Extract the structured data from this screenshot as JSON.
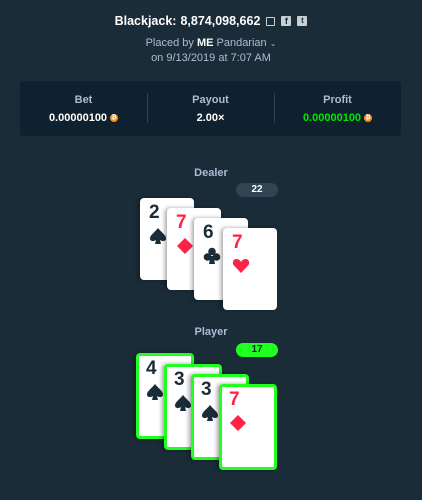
{
  "header": {
    "game": "Blackjack:",
    "bet_id": "8,874,098,662",
    "placed_prefix": "Placed by",
    "username_tag": "ME",
    "username": "Pandarian",
    "timestamp": "on 9/13/2019 at 7:07 AM"
  },
  "stats": {
    "bet_label": "Bet",
    "bet_value": "0.00000100",
    "payout_label": "Payout",
    "payout_value": "2.00×",
    "profit_label": "Profit",
    "profit_value": "0.00000100",
    "currency_icon": "bitcoin-icon"
  },
  "dealer": {
    "label": "Dealer",
    "score": "22",
    "cards": [
      {
        "rank": "2",
        "suit": "spade",
        "color": "#1a2c38"
      },
      {
        "rank": "7",
        "suit": "diamond",
        "color": "#fe2247"
      },
      {
        "rank": "6",
        "suit": "club",
        "color": "#1a2c38"
      },
      {
        "rank": "7",
        "suit": "heart",
        "color": "#fe2247"
      }
    ]
  },
  "player": {
    "label": "Player",
    "score": "17",
    "cards": [
      {
        "rank": "4",
        "suit": "spade",
        "color": "#1a2c38"
      },
      {
        "rank": "3",
        "suit": "spade",
        "color": "#1a2c38"
      },
      {
        "rank": "3",
        "suit": "spade",
        "color": "#1a2c38"
      },
      {
        "rank": "7",
        "suit": "diamond",
        "color": "#fe2247"
      }
    ]
  },
  "colors": {
    "background": "#1a2c38",
    "panel": "#0f212e",
    "win_green": "#1fff20",
    "red_suit": "#fe2247"
  }
}
